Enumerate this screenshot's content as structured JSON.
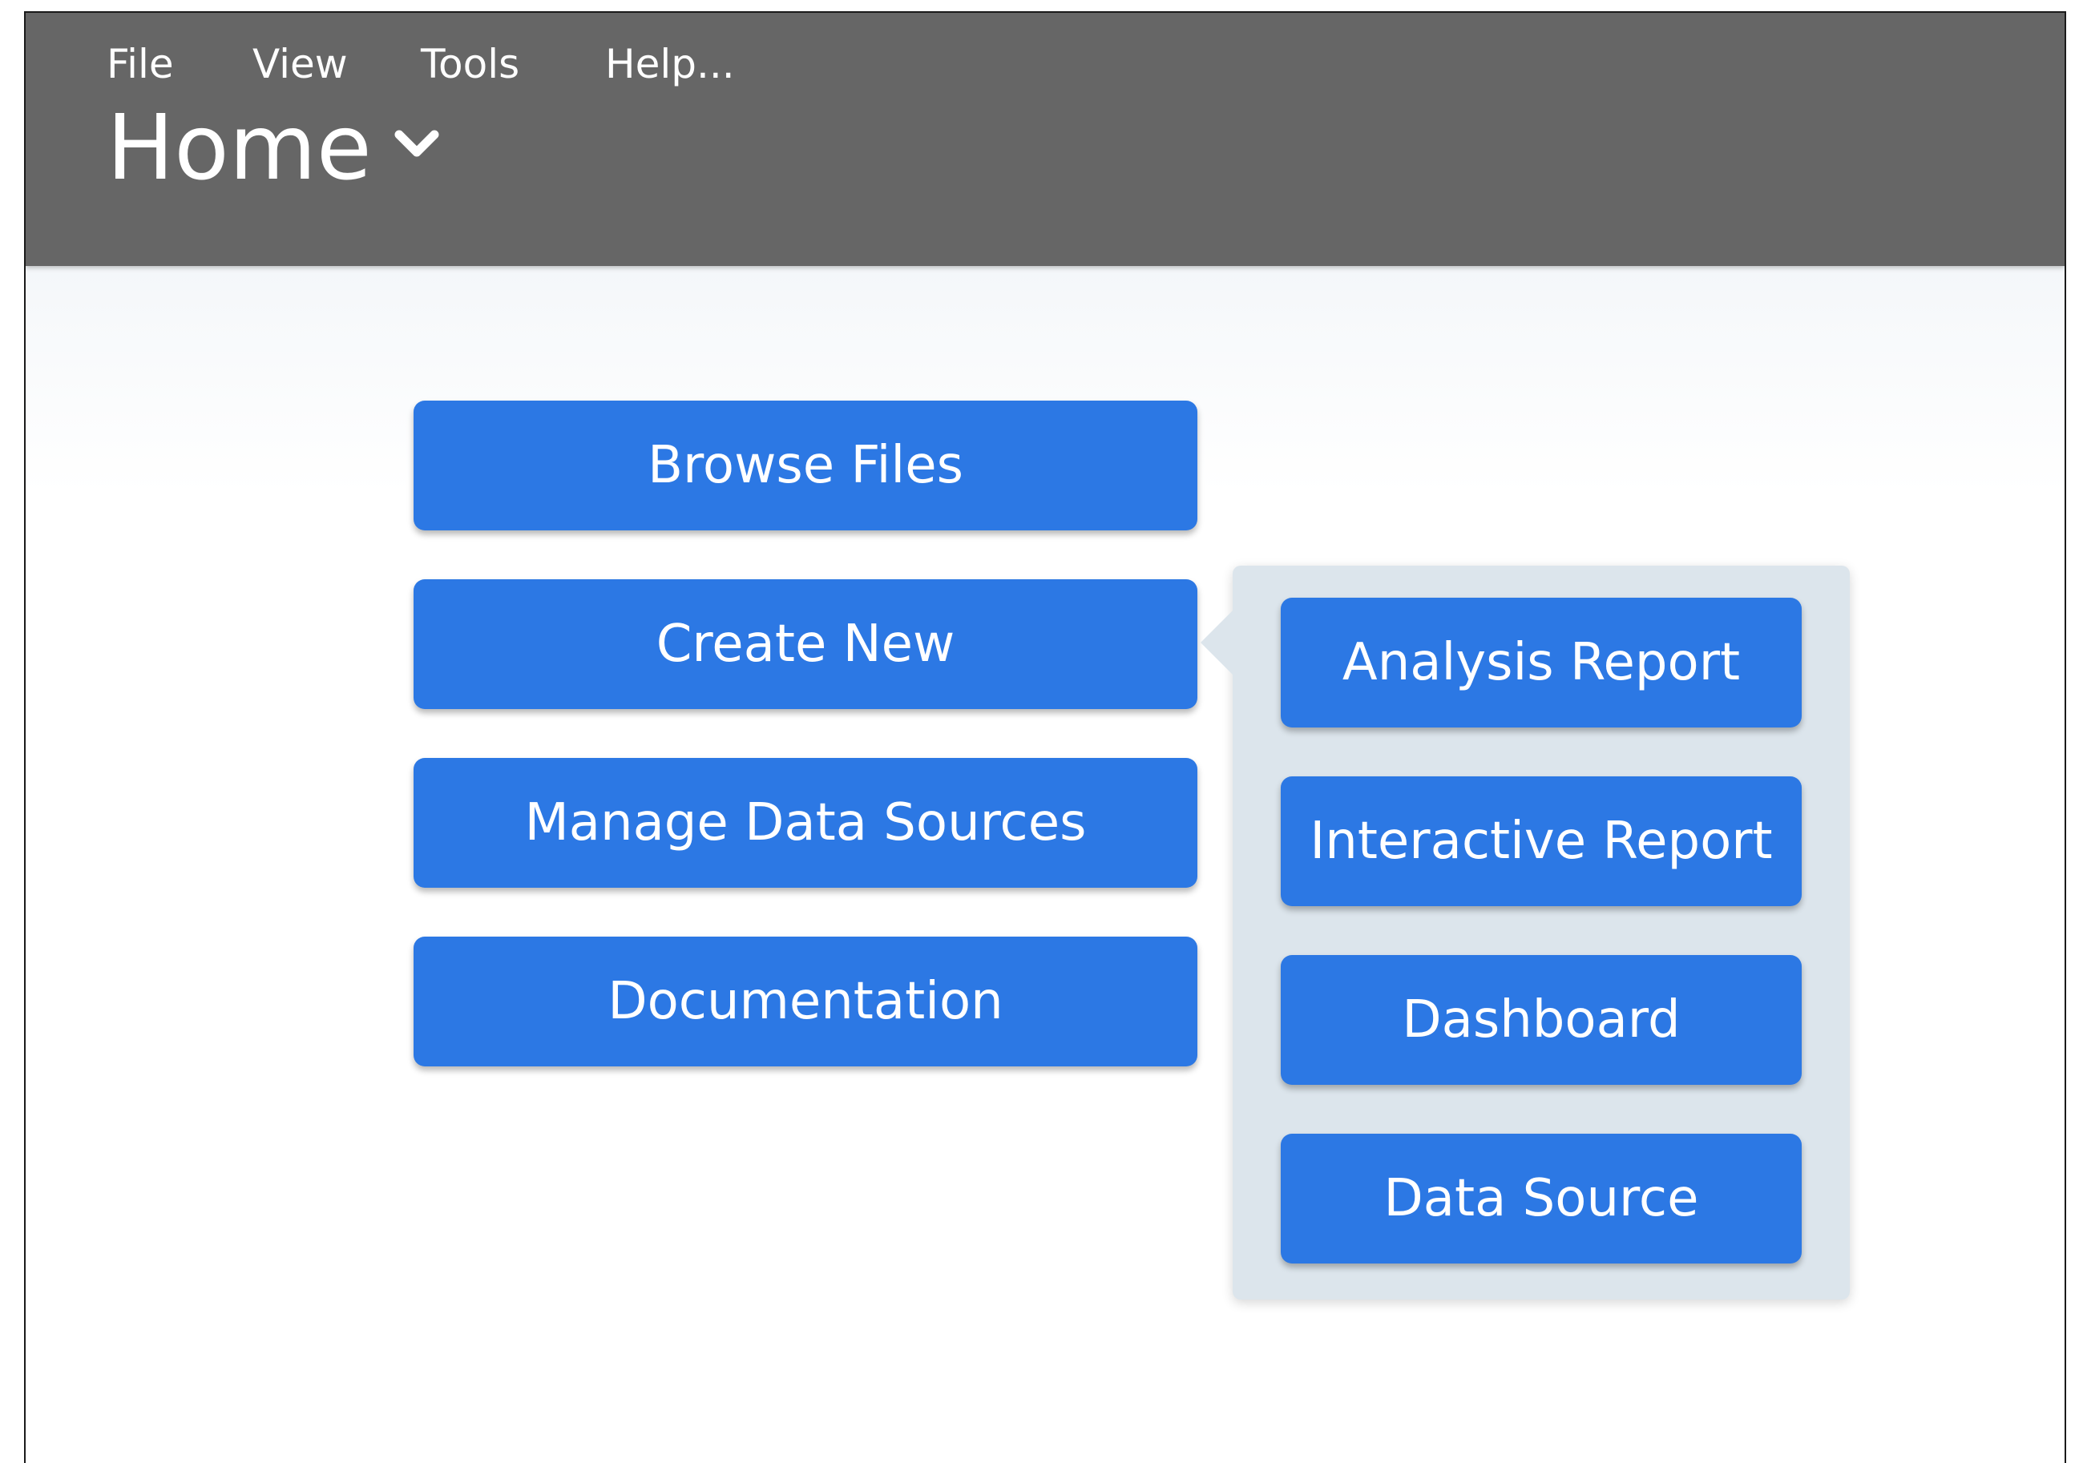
{
  "menubar": {
    "items": [
      {
        "label": "File"
      },
      {
        "label": "View"
      },
      {
        "label": "Tools"
      },
      {
        "label": "Help..."
      }
    ]
  },
  "page": {
    "title": "Home"
  },
  "main_actions": [
    {
      "label": "Browse Files"
    },
    {
      "label": "Create New"
    },
    {
      "label": "Manage Data Sources"
    },
    {
      "label": "Documentation"
    }
  ],
  "create_new_submenu": {
    "items": [
      {
        "label": "Analysis Report"
      },
      {
        "label": "Interactive Report"
      },
      {
        "label": "Dashboard"
      },
      {
        "label": "Data Source"
      }
    ]
  },
  "colors": {
    "header_bg": "#666666",
    "button_bg": "#2c78e4",
    "submenu_bg": "#dce5ec"
  },
  "icons": {
    "title_dropdown": "chevron-down-icon"
  }
}
